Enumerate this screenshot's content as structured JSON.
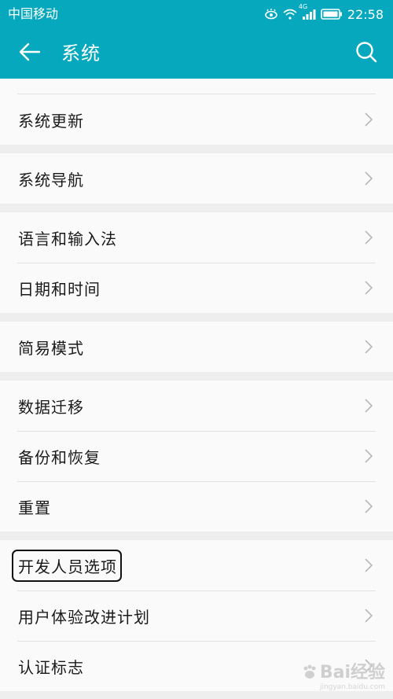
{
  "status_bar": {
    "carrier": "中国移动",
    "network": "4G",
    "time": "22:58"
  },
  "app_bar": {
    "title": "系统",
    "back_icon": "arrow-left-icon",
    "search_icon": "search-icon"
  },
  "groups": [
    {
      "items": [
        {
          "label": "系统更新"
        }
      ]
    },
    {
      "items": [
        {
          "label": "系统导航"
        }
      ]
    },
    {
      "items": [
        {
          "label": "语言和输入法"
        },
        {
          "label": "日期和时间"
        }
      ]
    },
    {
      "items": [
        {
          "label": "简易模式"
        }
      ]
    },
    {
      "items": [
        {
          "label": "数据迁移"
        },
        {
          "label": "备份和恢复"
        },
        {
          "label": "重置"
        }
      ]
    },
    {
      "items": [
        {
          "label": "开发人员选项"
        },
        {
          "label": "用户体验改进计划"
        },
        {
          "label": "认证标志"
        }
      ]
    }
  ],
  "watermark": {
    "text": "Bai经验",
    "url": "jingyan.baidu.com"
  },
  "colors": {
    "accent": "#06a8bd",
    "row_bg": "#fafafa",
    "page_bg": "#eeeeee"
  }
}
